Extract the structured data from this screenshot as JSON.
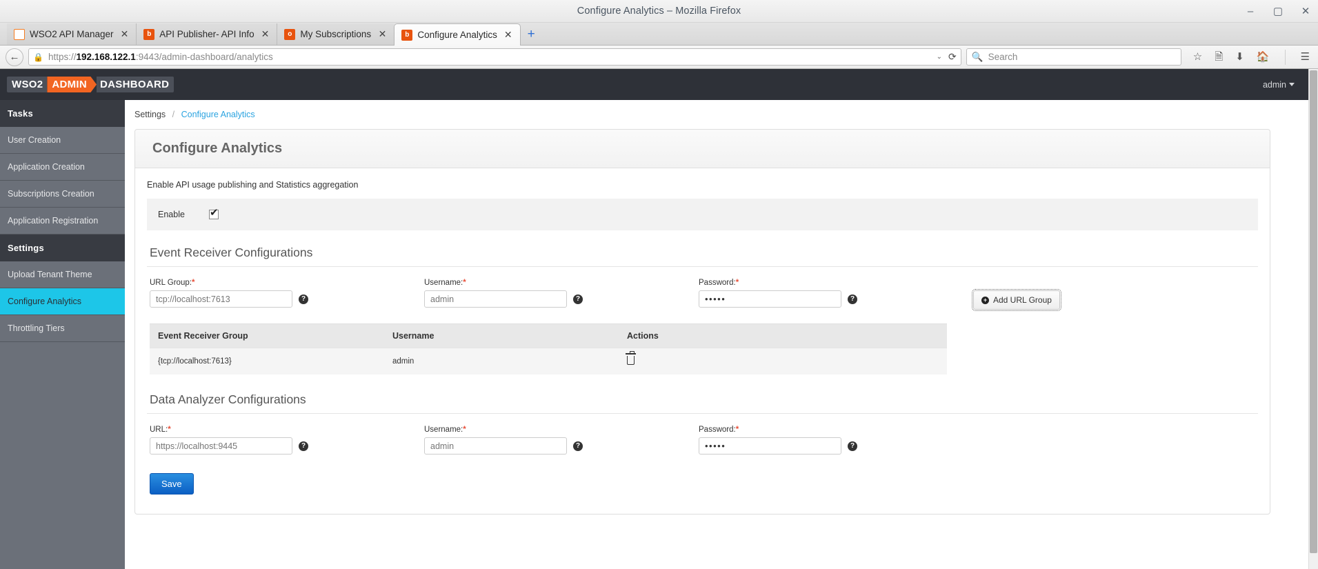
{
  "window": {
    "title": "Configure Analytics – Mozilla Firefox",
    "minimize": "–",
    "maximize": "▢",
    "close": "✕"
  },
  "browser": {
    "tabs": [
      {
        "label": "WSO2 API Manager",
        "favicon": "wso2-icon",
        "close": "✕",
        "active": false
      },
      {
        "label": "API Publisher- API Info",
        "favicon": "publisher-icon",
        "close": "✕",
        "active": false
      },
      {
        "label": "My Subscriptions",
        "favicon": "store-icon",
        "close": "✕",
        "active": false
      },
      {
        "label": "Configure Analytics",
        "favicon": "admin-icon",
        "close": "✕",
        "active": true
      }
    ],
    "new_tab": "+",
    "back": "←",
    "url_scheme": "https://",
    "url_host": "192.168.122.1",
    "url_path": ":9443/admin-dashboard/analytics",
    "url_full": "https://192.168.122.1:9443/admin-dashboard/analytics",
    "lock": "🔒",
    "dropdown_caret": "⌄",
    "reload": "⟳",
    "search_placeholder": "Search",
    "search_value": "",
    "search_icon": "🔍",
    "toolbar_icons": [
      "bookmark-star-icon",
      "reader-list-icon",
      "downloads-icon",
      "home-icon",
      "hamburger-menu-icon"
    ]
  },
  "app": {
    "logo": {
      "part1": "WSO2",
      "badge": "ADMIN",
      "part2": "DASHBOARD"
    },
    "user": "admin"
  },
  "sidebar": {
    "groups": [
      {
        "header": "Tasks",
        "items": [
          {
            "label": "User Creation",
            "active": false
          },
          {
            "label": "Application Creation",
            "active": false
          },
          {
            "label": "Subscriptions Creation",
            "active": false
          },
          {
            "label": "Application Registration",
            "active": false
          }
        ]
      },
      {
        "header": "Settings",
        "items": [
          {
            "label": "Upload Tenant Theme",
            "active": false
          },
          {
            "label": "Configure Analytics",
            "active": true
          },
          {
            "label": "Throttling Tiers",
            "active": false
          }
        ]
      }
    ],
    "active_color": "#1dc6e8"
  },
  "breadcrumb": {
    "root": "Settings",
    "separator": "/",
    "current": "Configure Analytics"
  },
  "page": {
    "title": "Configure Analytics",
    "lead": "Enable API usage publishing and Statistics aggregation",
    "enable": {
      "label": "Enable",
      "checked": true,
      "check_glyph": "✔"
    }
  },
  "event_receiver": {
    "section_title": "Event Receiver Configurations",
    "url_group": {
      "label": "URL Group:",
      "required": "*",
      "value": "tcp://localhost:7613",
      "help": "?"
    },
    "username": {
      "label": "Username:",
      "required": "*",
      "value": "admin",
      "help": "?"
    },
    "password": {
      "label": "Password:",
      "required": "*",
      "value": "•••••",
      "help": "?"
    },
    "add_button": {
      "label": "Add URL Group",
      "icon": "plus-circle-icon"
    },
    "table": {
      "headers": [
        "Event Receiver Group",
        "Username",
        "Actions"
      ],
      "rows": [
        {
          "group": "{tcp://localhost:7613}",
          "username": "admin",
          "action_icon": "trash-icon"
        }
      ]
    }
  },
  "data_analyzer": {
    "section_title": "Data Analyzer Configurations",
    "url": {
      "label": "URL:",
      "required": "*",
      "value": "https://localhost:9445",
      "help": "?"
    },
    "username": {
      "label": "Username:",
      "required": "*",
      "value": "admin",
      "help": "?"
    },
    "password": {
      "label": "Password:",
      "required": "*",
      "value": "•••••",
      "help": "?"
    }
  },
  "actions": {
    "save": "Save"
  }
}
